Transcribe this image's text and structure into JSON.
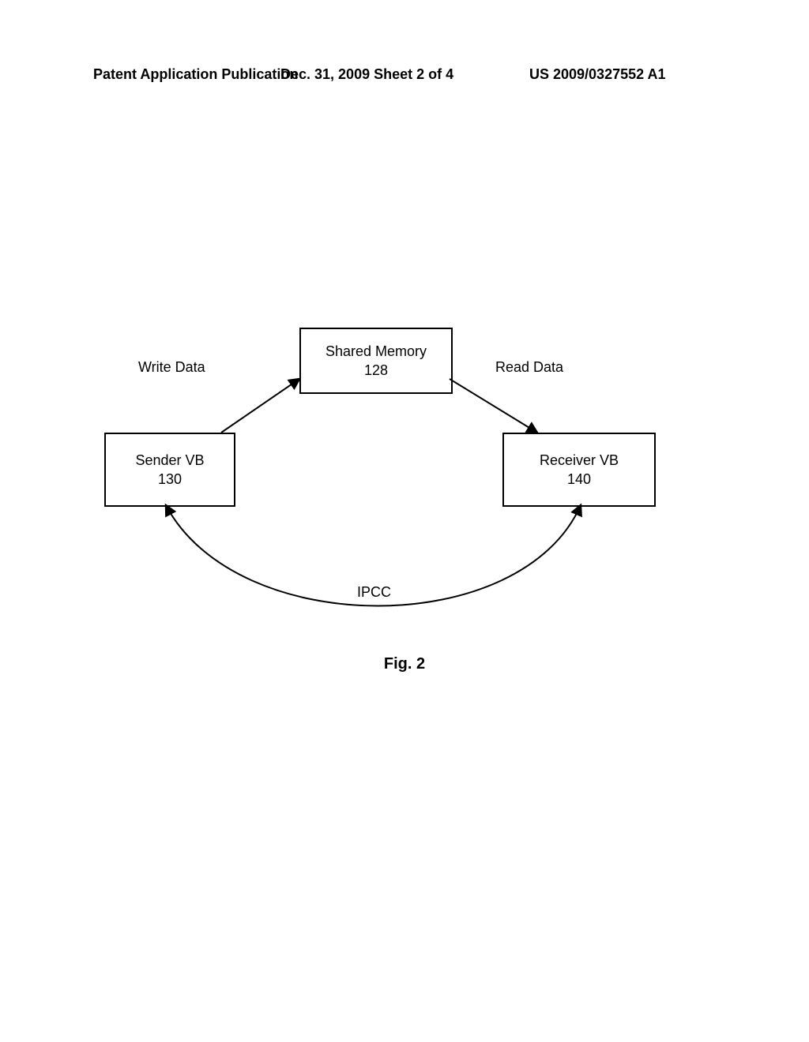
{
  "header": {
    "left": "Patent Application Publication",
    "mid": "Dec. 31, 2009  Sheet 2 of 4",
    "right": "US 2009/0327552 A1"
  },
  "labels": {
    "write_data": "Write Data",
    "read_data": "Read Data",
    "ipcc": "IPCC"
  },
  "boxes": {
    "shared_memory": {
      "title": "Shared Memory",
      "num": "128"
    },
    "sender_vb": {
      "title": "Sender VB",
      "num": "130"
    },
    "receiver_vb": {
      "title": "Receiver VB",
      "num": "140"
    }
  },
  "figure_caption": "Fig. 2"
}
